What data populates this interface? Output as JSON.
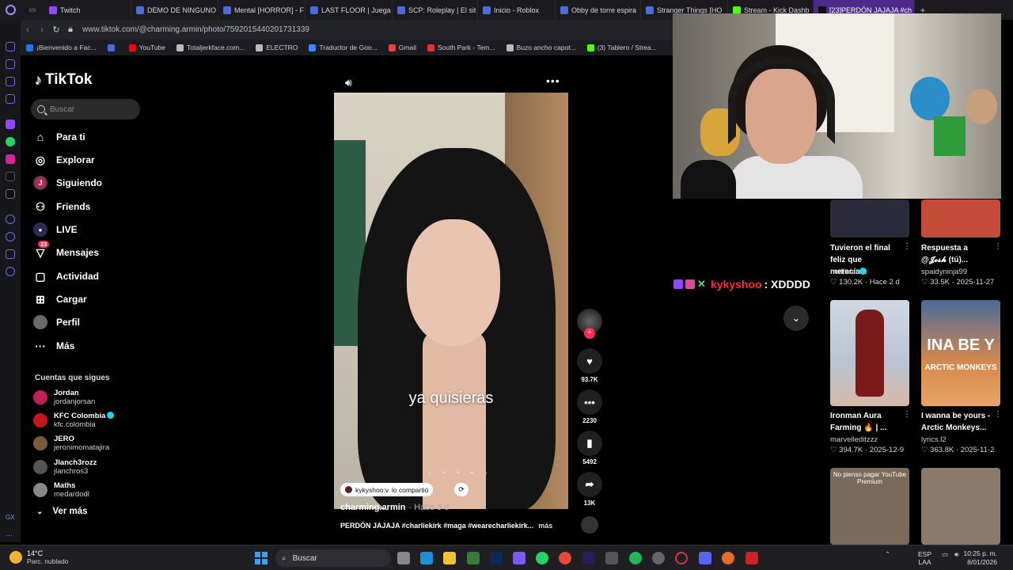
{
  "browser": {
    "tabs": [
      {
        "label": "Twitch",
        "color": "#9146ff"
      },
      {
        "label": "DEMO DE NINGUNO",
        "color": "#4a6cd8"
      },
      {
        "label": "Mental [HORROR] - F",
        "color": "#4a6cd8"
      },
      {
        "label": "LAST FLOOR | Juega",
        "color": "#4a6cd8"
      },
      {
        "label": "SCP: Roleplay | El sit",
        "color": "#4a6cd8"
      },
      {
        "label": "Inicio - Roblox",
        "color": "#4a6cd8"
      },
      {
        "label": "Obby de torre espira",
        "color": "#4a6cd8"
      },
      {
        "label": "Stranger Things [HO",
        "color": "#4a6cd8"
      },
      {
        "label": "Stream - Kick Dashb",
        "color": "#53fc18"
      },
      {
        "label": "[23]PERDÓN JAJAJA #ch",
        "color": "#111111"
      }
    ],
    "url": "www.tiktok.com/@charming.armin/photo/7592015440201731339",
    "bookmarks": [
      {
        "label": "¡Bienvenido a Fac...",
        "color": "#1877f2"
      },
      {
        "label": "",
        "color": "#4a6cd8"
      },
      {
        "label": "YouTube",
        "color": "#ff0000"
      },
      {
        "label": "Totaljerkface.com...",
        "color": "#bbbbbb"
      },
      {
        "label": "ELECTRO",
        "color": "#bbbbbb"
      },
      {
        "label": "Traductor de Goo...",
        "color": "#4285f4"
      },
      {
        "label": "Gmail",
        "color": "#ea4335"
      },
      {
        "label": "South Park - Tem...",
        "color": "#d33"
      },
      {
        "label": "Buzo ancho capot...",
        "color": "#bbbbbb"
      },
      {
        "label": "(3) Tablero / Strea...",
        "color": "#53fc18"
      }
    ]
  },
  "tiktok": {
    "logo": "TikTok",
    "search_placeholder": "Buscar",
    "nav": [
      {
        "label": "Para ti",
        "icon": "home-icon",
        "glyph": "⌂"
      },
      {
        "label": "Explorar",
        "icon": "compass-icon",
        "glyph": "◎"
      },
      {
        "label": "Siguiendo",
        "icon": "following-avatar-icon",
        "glyph": "J"
      },
      {
        "label": "Friends",
        "icon": "friends-icon",
        "glyph": "⚇"
      },
      {
        "label": "LIVE",
        "icon": "live-icon",
        "glyph": "●"
      },
      {
        "label": "Mensajes",
        "icon": "messages-icon",
        "glyph": "▽",
        "badge": "23"
      },
      {
        "label": "Actividad",
        "icon": "activity-icon",
        "glyph": "▢"
      },
      {
        "label": "Cargar",
        "icon": "upload-icon",
        "glyph": "⊞"
      },
      {
        "label": "Perfil",
        "icon": "profile-icon",
        "glyph": "●"
      },
      {
        "label": "Más",
        "icon": "more-dots-icon",
        "glyph": "···"
      }
    ],
    "following_title": "Cuentas que sigues",
    "following": [
      {
        "name": "Jordan",
        "handle": "jordanjorsan",
        "color": "#c0205a",
        "verified": false
      },
      {
        "name": "KFC Colombia",
        "handle": "kfc.colombia",
        "color": "#c4161c",
        "verified": true
      },
      {
        "name": "JERO",
        "handle": "jeronimomatajira",
        "color": "#7a5a3a",
        "verified": false
      },
      {
        "name": "Jlanch3rozz",
        "handle": "jlanchros3",
        "color": "#555555",
        "verified": false
      },
      {
        "name": "Maths",
        "handle": "medardodl",
        "color": "#888888",
        "verified": false
      }
    ],
    "see_more": "Ver más"
  },
  "post": {
    "overlay_text": "ya quisieras",
    "shared_by": "kykyshoo:v",
    "shared_label": "lo compartió",
    "author": "charming.armin",
    "time": "· Hace 3 d",
    "caption": "PERDÓN JAJAJA #charliekirk #maga #wearecharliekirk...",
    "caption_more": "más",
    "likes": "93.7K",
    "comments": "2230",
    "saves": "5492",
    "shares": "13K"
  },
  "stream_chat": {
    "user": "kykyshoo",
    "message": ": XDDDD"
  },
  "related": [
    {
      "title": "Tuvieron el final feliz que merecía...",
      "user": "netflixlat",
      "verified": true,
      "likes": "130.2K",
      "date": "Hace 2 d",
      "thumb": "",
      "bg": "#2a2a3a"
    },
    {
      "title": "Respuesta a @𝓙𝓸𝓼𝓱 (tú)...",
      "user": "spaidyninja99",
      "verified": false,
      "likes": "33.5K",
      "date": "2025-11-27",
      "thumb": "",
      "bg": "#c44a3a"
    },
    {
      "title": "Ironman Aura Farming 🔥 | ...",
      "user": "marvelleditzzz",
      "verified": false,
      "likes": "394.7K",
      "date": "2025-12-9",
      "thumb": "",
      "bg": "#b8c4d0"
    },
    {
      "title": "I wanna be yours - Arctic Monkeys...",
      "user": "lyrics.l2",
      "verified": false,
      "likes": "363.8K",
      "date": "2025-11-2",
      "thumb": "INA BE Y",
      "thumb2": "ARCTIC MONKEYS",
      "bg": "#d88a4a"
    },
    {
      "title": "",
      "user": "",
      "verified": false,
      "likes": "",
      "date": "",
      "thumb": "No pienso pagar YouTube Premium",
      "bg": "#7a6a5a"
    },
    {
      "title": "",
      "user": "",
      "verified": false,
      "likes": "",
      "date": "",
      "thumb": "",
      "bg": "#8a7a6a"
    }
  ],
  "taskbar": {
    "temp": "14°C",
    "weather": "Parc. nublado",
    "search": "Buscar",
    "lang1": "ESP",
    "lang2": "LAA",
    "time": "10:25 p. m.",
    "date": "8/01/2026"
  }
}
